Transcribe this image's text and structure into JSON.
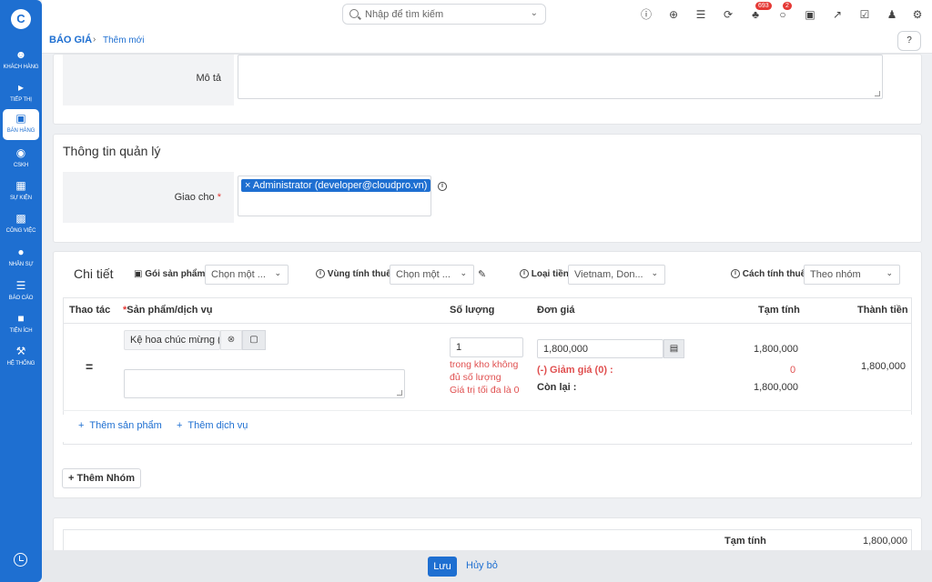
{
  "sidebar": {
    "logo": "C",
    "items": [
      {
        "label": "KHÁCH HÀNG",
        "icon": "users-icon"
      },
      {
        "label": "TIẾP THỊ",
        "icon": "megaphone-icon"
      },
      {
        "label": "BÁN HÀNG",
        "icon": "cart-icon"
      },
      {
        "label": "CSKH",
        "icon": "support-icon"
      },
      {
        "label": "SỰ KIỆN",
        "icon": "calendar-icon"
      },
      {
        "label": "CÔNG VIỆC",
        "icon": "briefcase-icon"
      },
      {
        "label": "NHÂN SỰ",
        "icon": "person-icon"
      },
      {
        "label": "BÁO CÁO",
        "icon": "report-icon"
      },
      {
        "label": "TIỆN ÍCH",
        "icon": "box-icon"
      },
      {
        "label": "HỆ THỐNG",
        "icon": "wrench-icon"
      }
    ]
  },
  "topbar": {
    "search_placeholder": "Nhập để tìm kiếm",
    "notifications_count": "693",
    "messages_count": "2"
  },
  "breadcrumb": {
    "module": "BÁO GIÁ",
    "current": "Thêm mới"
  },
  "description": {
    "label": "Mô tả",
    "value": ""
  },
  "management": {
    "title": "Thông tin quản lý",
    "assign_label": "Giao cho",
    "required_mark": "*",
    "assignee": "Administrator (developer@cloudpro.vn)",
    "remove_mark": "×"
  },
  "details": {
    "title": "Chi tiết",
    "package_label": "Gói sản phẩm",
    "package_value": "Chọn một ...",
    "tax_region_label": "Vùng tính thuế",
    "tax_region_value": "Chọn một ...",
    "currency_label": "Loại tiền",
    "currency_value": "Vietnam, Don...",
    "tax_method_label": "Cách tính thuế",
    "tax_method_value": "Theo nhóm",
    "columns": {
      "action": "Thao tác",
      "product": "Sản phẩm/dịch vụ",
      "quantity": "Số lượng",
      "unit_price": "Đơn giá",
      "subtotal": "Tạm tính",
      "total": "Thành tiền"
    },
    "row": {
      "product_name": "Kệ hoa chúc mừng (gỗ",
      "quantity": "1",
      "stock_warning_1": "trong kho không",
      "stock_warning_2": "đủ số lượng",
      "max_value_note": "Giá trị tối đa là 0",
      "unit_price": "1,800,000",
      "discount_label": "(-) Giảm giá (0) :",
      "discount_value": "0",
      "remaining_label": "Còn lại :",
      "remaining_value": "1,800,000",
      "subtotal": "1,800,000",
      "total": "1,800,000",
      "note": ""
    },
    "add_product": "Thêm sản phẩm",
    "add_service": "Thêm dịch vụ",
    "add_group": "Thêm Nhóm"
  },
  "summary": {
    "subtotal_label": "Tạm tính",
    "subtotal_value": "1,800,000"
  },
  "footer": {
    "save_label": "Lưu",
    "cancel_label": "Hủy bỏ"
  }
}
